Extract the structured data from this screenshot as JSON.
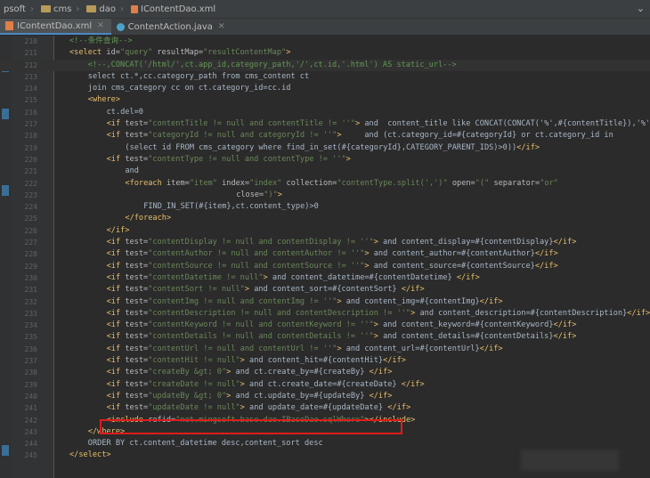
{
  "breadcrumb": {
    "items": [
      "psoft",
      "cms",
      "dao",
      "IContentDao.xml"
    ],
    "right_icon": "chevron-down"
  },
  "tabs": [
    {
      "label": "IContentDao.xml",
      "icon": "xml-file-icon",
      "active": true
    },
    {
      "label": "ContentAction.java",
      "icon": "java-class-icon",
      "active": false
    }
  ],
  "editor": {
    "lines": [
      {
        "n": "210",
        "html": "<span class='cm'>&lt;!--条件查询--&gt;</span>",
        "indent": 3
      },
      {
        "n": "211",
        "html": "<span class='tg'>&lt;select</span> <span class='at'>id=</span><span class='sv'>\"query\"</span> <span class='at'>resultMap=</span><span class='sv'>\"resultContentMap\"</span><span class='tg'>&gt;</span>",
        "indent": 3
      },
      {
        "n": "212",
        "html": "<span class='cm'>&lt;!--,CONCAT('/html/',ct.app_id,category_path,'/',ct.id,'.html') AS static_url--&gt;</span>",
        "indent": 5,
        "current": true
      },
      {
        "n": "213",
        "html": "select ct.*,cc.category_path from cms_content ct",
        "indent": 5
      },
      {
        "n": "214",
        "html": "join cms_category cc on ct.category_id=cc.id",
        "indent": 5
      },
      {
        "n": "215",
        "html": "<span class='tg'>&lt;where&gt;</span>",
        "indent": 5
      },
      {
        "n": "216",
        "html": "ct.del=0",
        "indent": 7
      },
      {
        "n": "217",
        "html": "<span class='tg'>&lt;if</span> <span class='at'>test=</span><span class='sv'>\"contentTitle != null and contentTitle != ''\"</span><span class='tg'>&gt;</span> and  content_title like CONCAT(CONCAT('%',#{contentTitle}),'%')<span class='tg'>&lt;/if&gt;</span>",
        "indent": 7
      },
      {
        "n": "218",
        "html": "<span class='tg'>&lt;if</span> <span class='at'>test=</span><span class='sv'>\"categoryId != null and categoryId != ''\"</span><span class='tg'>&gt;</span>     and (ct.category_id=#{categoryId} or ct.category_id in",
        "indent": 7
      },
      {
        "n": "219",
        "html": "(select id FROM cms_category where find_in_set(#{categoryId},CATEGORY_PARENT_IDS)&gt;0))<span class='tg'>&lt;/if&gt;</span>",
        "indent": 9
      },
      {
        "n": "220",
        "html": "<span class='tg'>&lt;if</span> <span class='at'>test=</span><span class='sv'>\"contentType != null and contentType != ''\"</span><span class='tg'>&gt;</span>",
        "indent": 7
      },
      {
        "n": "221",
        "html": "and",
        "indent": 9
      },
      {
        "n": "222",
        "html": "<span class='tg'>&lt;foreach</span> <span class='at'>item=</span><span class='sv'>\"item\"</span> <span class='at'>index=</span><span class='sv'>\"index\"</span> <span class='at'>collection=</span><span class='sv'>\"contentType.split(',')\"</span> <span class='at'>open=</span><span class='sv'>\"(\"</span> <span class='at'>separator=</span><span class='sv'>\"or\"</span>",
        "indent": 9
      },
      {
        "n": "223",
        "html": "<span class='at'>close=</span><span class='sv'>\")\"</span><span class='tg'>&gt;</span>",
        "indent": 21
      },
      {
        "n": "224",
        "html": "FIND_IN_SET(#{item},ct.content_type)&gt;0",
        "indent": 11
      },
      {
        "n": "225",
        "html": "<span class='tg'>&lt;/foreach&gt;</span>",
        "indent": 9
      },
      {
        "n": "226",
        "html": "<span class='tg'>&lt;/if&gt;</span>",
        "indent": 7
      },
      {
        "n": "227",
        "html": "<span class='tg'>&lt;if</span> <span class='at'>test=</span><span class='sv'>\"contentDisplay != null and contentDisplay != ''\"</span><span class='tg'>&gt;</span> and content_display=#{contentDisplay}<span class='tg'>&lt;/if&gt;</span>",
        "indent": 7
      },
      {
        "n": "228",
        "html": "<span class='tg'>&lt;if</span> <span class='at'>test=</span><span class='sv'>\"contentAuthor != null and contentAuthor != ''\"</span><span class='tg'>&gt;</span> and content_author=#{contentAuthor}<span class='tg'>&lt;/if&gt;</span>",
        "indent": 7
      },
      {
        "n": "229",
        "html": "<span class='tg'>&lt;if</span> <span class='at'>test=</span><span class='sv'>\"contentSource != null and contentSource != ''\"</span><span class='tg'>&gt;</span> and content_source=#{contentSource}<span class='tg'>&lt;/if&gt;</span>",
        "indent": 7
      },
      {
        "n": "230",
        "html": "<span class='tg'>&lt;if</span> <span class='at'>test=</span><span class='sv'>\"contentDatetime != null\"</span><span class='tg'>&gt;</span> and content_datetime=#{contentDatetime} <span class='tg'>&lt;/if&gt;</span>",
        "indent": 7
      },
      {
        "n": "231",
        "html": "<span class='tg'>&lt;if</span> <span class='at'>test=</span><span class='sv'>\"contentSort != null\"</span><span class='tg'>&gt;</span> and content_sort=#{contentSort} <span class='tg'>&lt;/if&gt;</span>",
        "indent": 7
      },
      {
        "n": "232",
        "html": "<span class='tg'>&lt;if</span> <span class='at'>test=</span><span class='sv'>\"contentImg != null and contentImg != ''\"</span><span class='tg'>&gt;</span> and content_img=#{contentImg}<span class='tg'>&lt;/if&gt;</span>",
        "indent": 7
      },
      {
        "n": "233",
        "html": "<span class='tg'>&lt;if</span> <span class='at'>test=</span><span class='sv'>\"contentDescription != null and contentDescription != ''\"</span><span class='tg'>&gt;</span> and content_description=#{contentDescription}<span class='tg'>&lt;/if&gt;</span>",
        "indent": 7
      },
      {
        "n": "234",
        "html": "<span class='tg'>&lt;if</span> <span class='at'>test=</span><span class='sv'>\"contentKeyword != null and contentKeyword != ''\"</span><span class='tg'>&gt;</span> and content_keyword=#{contentKeyword}<span class='tg'>&lt;/if&gt;</span>",
        "indent": 7
      },
      {
        "n": "235",
        "html": "<span class='tg'>&lt;if</span> <span class='at'>test=</span><span class='sv'>\"contentDetails != null and contentDetails != ''\"</span><span class='tg'>&gt;</span> and content_details=#{contentDetails}<span class='tg'>&lt;/if&gt;</span>",
        "indent": 7
      },
      {
        "n": "236",
        "html": "<span class='tg'>&lt;if</span> <span class='at'>test=</span><span class='sv'>\"contentUrl != null and contentUrl != ''\"</span><span class='tg'>&gt;</span> and content_url=#{contentUrl}<span class='tg'>&lt;/if&gt;</span>",
        "indent": 7
      },
      {
        "n": "237",
        "html": "<span class='tg'>&lt;if</span> <span class='at'>test=</span><span class='sv'>\"contentHit != null\"</span><span class='tg'>&gt;</span> and content_hit=#{contentHit}<span class='tg'>&lt;/if&gt;</span>",
        "indent": 7
      },
      {
        "n": "238",
        "html": "<span class='tg'>&lt;if</span> <span class='at'>test=</span><span class='sv'>\"createBy &amp;gt; 0\"</span><span class='tg'>&gt;</span> and ct.create_by=#{createBy} <span class='tg'>&lt;/if&gt;</span>",
        "indent": 7
      },
      {
        "n": "239",
        "html": "<span class='tg'>&lt;if</span> <span class='at'>test=</span><span class='sv'>\"createDate != null\"</span><span class='tg'>&gt;</span> and ct.create_date=#{createDate} <span class='tg'>&lt;/if&gt;</span>",
        "indent": 7
      },
      {
        "n": "240",
        "html": "<span class='tg'>&lt;if</span> <span class='at'>test=</span><span class='sv'>\"updateBy &amp;gt; 0\"</span><span class='tg'>&gt;</span> and ct.update_by=#{updateBy} <span class='tg'>&lt;/if&gt;</span>",
        "indent": 7
      },
      {
        "n": "241",
        "html": "<span class='tg'>&lt;if</span> <span class='at'>test=</span><span class='sv'>\"updateDate != null\"</span><span class='tg'>&gt;</span> and update_date=#{updateDate} <span class='tg'>&lt;/if&gt;</span>",
        "indent": 7
      },
      {
        "n": "242",
        "html": "<span class='tg'>&lt;include</span> <span class='at'>refid=</span><span class='sv'>\"net.mingsoft.base.dao.IBaseDao.sqlWhere\"</span><span class='tg'>&gt;&lt;/include&gt;</span>",
        "indent": 7
      },
      {
        "n": "243",
        "html": "<span class='tg'>&lt;/where&gt;</span>",
        "indent": 5
      },
      {
        "n": "244",
        "html": "ORDER BY ct.content_datetime desc,content_sort desc",
        "indent": 5
      },
      {
        "n": "245",
        "html": "<span class='tg'>&lt;/select&gt;</span>",
        "indent": 3
      }
    ]
  }
}
